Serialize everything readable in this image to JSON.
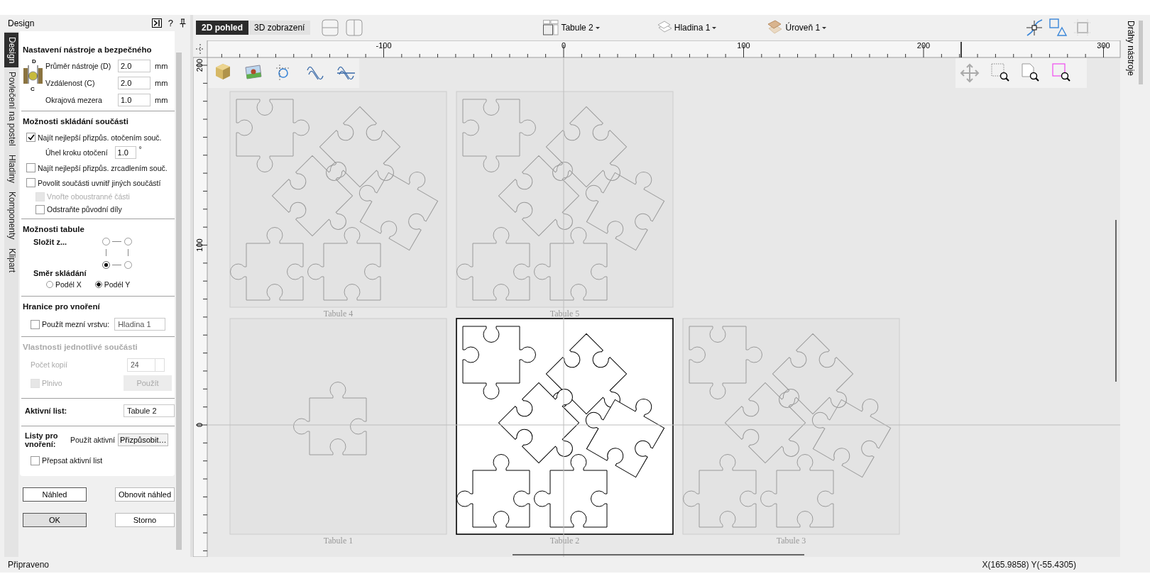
{
  "panel": {
    "title": "Design",
    "help": "?"
  },
  "vertical_tabs": [
    {
      "label": "Design",
      "selected": true
    },
    {
      "label": "Povlečení na postel",
      "selected": false
    },
    {
      "label": "Hladiny",
      "selected": false
    },
    {
      "label": "Komponenty",
      "selected": false
    },
    {
      "label": "Klipart",
      "selected": false
    }
  ],
  "tool_settings": {
    "title": "Nastavení nástroje a bezpečného",
    "diagram_labels": [
      "D",
      "C"
    ],
    "fields": [
      {
        "label": "Průměr nástroje (D)",
        "value": "2.0",
        "unit": "mm"
      },
      {
        "label": "Vzdálenost (C)",
        "value": "2.0",
        "unit": "mm"
      },
      {
        "label": "Okrajová mezera",
        "value": "1.0",
        "unit": "mm"
      }
    ]
  },
  "nesting_options": {
    "title": "Možnosti skládání součásti",
    "items": [
      {
        "kind": "checkbox",
        "label": "Najít nejlepší přizpůs. otočením souč.",
        "checked": true
      },
      {
        "kind": "field",
        "label": "Úhel kroku otočení",
        "value": "1.0",
        "unit": "°"
      },
      {
        "kind": "checkbox",
        "label": "Najít nejlepší přizpůs. zrcadlením souč.",
        "checked": false
      },
      {
        "kind": "checkbox",
        "label": "Povolit součásti uvnitř jiných součástí",
        "checked": false,
        "children": [
          {
            "label": "Vnořte oboustranné části",
            "checked": false,
            "disabled": true
          },
          {
            "label": "Odstraňte původní díly",
            "checked": false,
            "disabled": false
          }
        ]
      }
    ]
  },
  "sheet_options": {
    "title": "Možnosti tabule",
    "compose_label": "Složit z...",
    "corners": [
      {
        "selected": false
      },
      {
        "selected": false
      },
      {
        "selected": true
      },
      {
        "selected": false
      }
    ],
    "direction_label": "Směr skládání",
    "directions": [
      {
        "label": "Podél X",
        "selected": false
      },
      {
        "label": "Podél Y",
        "selected": true
      }
    ]
  },
  "nesting_boundary": {
    "title": "Hranice pro vnoření",
    "checkbox": {
      "label": "Použít mezní vrstvu:",
      "checked": false
    },
    "layer": "Hladina 1"
  },
  "part_properties": {
    "title": "Vlastnosti jednotlivé součásti",
    "disabled": true,
    "copies_label": "Počet kopií",
    "copies": "24",
    "fill": {
      "label": "Plnivo",
      "checked": false
    },
    "apply": "Použít"
  },
  "active_sheet": {
    "label": "Aktivní list:",
    "value": "Tabule 2"
  },
  "nesting_sheets": {
    "label": "Listy pro vnoření:",
    "mode": "Použít aktivní",
    "customize": "Přizpůsobit…",
    "overwrite": {
      "label": "Přepsat aktivní list",
      "checked": false
    }
  },
  "panel_buttons": {
    "preview": "Náhled",
    "refresh": "Obnovit náhled",
    "ok": "OK",
    "cancel": "Storno"
  },
  "view_tabs": [
    {
      "label": "2D pohled",
      "selected": true
    },
    {
      "label": "3D zobrazení",
      "selected": false
    }
  ],
  "dropdowns": [
    {
      "label": "Tabule 2"
    },
    {
      "label": "Hladina 1"
    },
    {
      "label": "Úroveň 1"
    }
  ],
  "right_tab": "Dráhy nástroje",
  "ruler": {
    "x_labels": [
      "-100",
      "0",
      "100",
      "200",
      "300"
    ],
    "y_labels": [
      "200",
      "100",
      "0"
    ]
  },
  "sheets": [
    {
      "label": "Tabule 4",
      "kind": "nested",
      "selected": false
    },
    {
      "label": "Tabule 5",
      "kind": "nested",
      "selected": false
    },
    {
      "label": "Tabule 1",
      "kind": "single",
      "selected": false
    },
    {
      "label": "Tabule 2",
      "kind": "nested",
      "selected": true
    },
    {
      "label": "Tabule 3",
      "kind": "nested",
      "selected": false
    }
  ],
  "status_bar": {
    "message": "Připraveno",
    "coordinates": "X(165.9858) Y(-55.4305)"
  }
}
